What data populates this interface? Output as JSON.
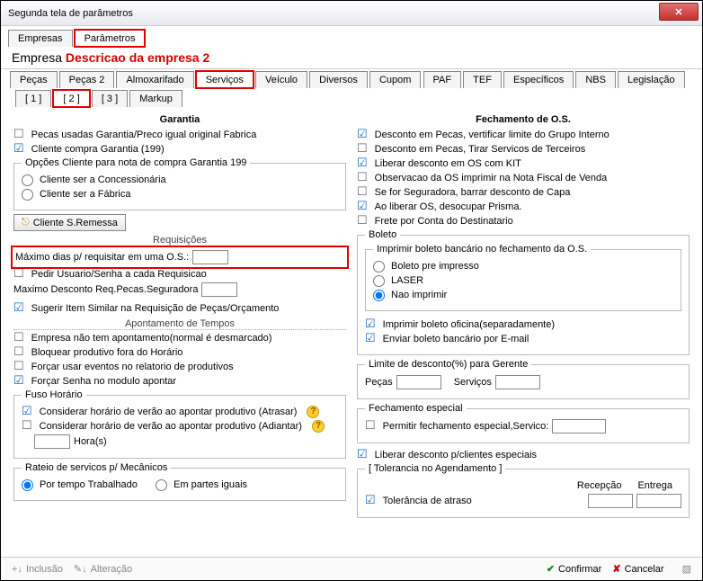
{
  "window": {
    "title": "Segunda tela de parâmetros"
  },
  "tabs1": [
    "Empresas",
    "Parâmetros"
  ],
  "company": {
    "label": "Empresa",
    "desc": "Descricao da empresa 2"
  },
  "tabs2": [
    "Peças",
    "Peças 2",
    "Almoxarifado",
    "Serviços",
    "Veículo",
    "Diversos",
    "Cupom",
    "PAF",
    "TEF",
    "Específicos",
    "NBS",
    "Legislação"
  ],
  "tabs3": [
    "[ 1 ]",
    "[ 2 ]",
    "[ 3 ]",
    "Markup"
  ],
  "left": {
    "garantia": {
      "title": "Garantia",
      "chk1": "Pecas usadas Garantia/Preco igual original Fabrica",
      "chk2": "Cliente compra Garantia (199)",
      "opcoes_legend": "Opções Cliente para nota de compra Garantia 199",
      "r1": "Cliente ser a Concessionária",
      "r2": "Cliente ser a Fábrica",
      "btn": "Cliente S.Remessa"
    },
    "req": {
      "title": "Requisições",
      "max_label": "Máximo dias p/ requisitar em uma O.S.:",
      "chk_pedir": "Pedir Usuario/Senha a cada Requisicao",
      "max_desc": "Maximo Desconto Req.Pecas.Seguradora",
      "chk_sug": "Sugerir Item Similar na Requisição de Peças/Orçamento"
    },
    "apont": {
      "title": "Apontamento de Tempos",
      "a1": "Empresa não tem apontamento(normal é desmarcado)",
      "a2": "Bloquear produtivo fora do Horário",
      "a3": "Forçar usar eventos no relatorio de produtivos",
      "a4": "Forçar Senha no modulo apontar"
    },
    "fuso": {
      "title": "Fuso Horário",
      "f1": "Considerar horário de verão ao apontar produtivo (Atrasar)",
      "f2": "Considerar horário de verão ao apontar produtivo (Adiantar)",
      "horas": "Hora(s)"
    },
    "rateio": {
      "title": "Rateio de servicos p/ Mecânicos",
      "r1": "Por tempo Trabalhado",
      "r2": "Em partes iguais"
    }
  },
  "right": {
    "fech": {
      "title": "Fechamento de O.S.",
      "c1": "Desconto em Pecas, vertificar limite do Grupo Interno",
      "c2": "Desconto em Pecas, Tirar Servicos de Terceiros",
      "c3": "Liberar desconto em OS com KIT",
      "c4": "Observacao da OS imprimir na Nota Fiscal de Venda",
      "c5": "Se for Seguradora, barrar desconto de Capa",
      "c6": "Ao liberar OS, desocupar Prisma.",
      "c7": "Frete por Conta do Destinatario"
    },
    "boleto": {
      "title": "Boleto",
      "sub": "Imprimir boleto bancário no fechamento da O.S.",
      "r1": "Boleto pre impresso",
      "r2": "LASER",
      "r3": "Nao imprimir",
      "sep1": "Imprimir boleto oficina(separadamente)",
      "sep2": "Enviar boleto bancário por E-mail"
    },
    "lim": {
      "title": "Limite de desconto(%) para Gerente",
      "pecas": "Peças",
      "serv": "Serviços"
    },
    "fechesp": {
      "title": "Fechamento especial",
      "chk": "Permitir fechamento especial,Servico:"
    },
    "lib": "Liberar desconto p/clientes especiais",
    "tol": {
      "title": "[ Tolerancia no Agendamento ]",
      "rec": "Recepção",
      "ent": "Entrega",
      "chk": "Tolerância de atraso"
    }
  },
  "footer": {
    "inc": "Inclusão",
    "alt": "Alteração",
    "conf": "Confirmar",
    "canc": "Cancelar"
  }
}
